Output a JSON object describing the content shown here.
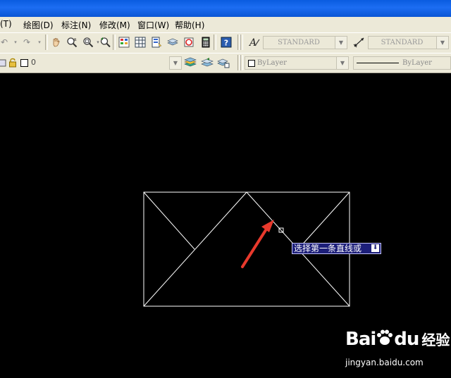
{
  "menubar": {
    "items": [
      {
        "label": "(T)"
      },
      {
        "label": "绘图(D)"
      },
      {
        "label": "标注(N)"
      },
      {
        "label": "修改(M)"
      },
      {
        "label": "窗口(W)"
      },
      {
        "label": "帮助(H)"
      }
    ]
  },
  "toolbar": {
    "text_style": "STANDARD",
    "dim_style": "STANDARD",
    "layer_value": "0",
    "color_value": "ByLayer",
    "linetype_value": "ByLayer"
  },
  "command_tooltip": {
    "text": "选择第一条直线或"
  },
  "watermark": {
    "brand": "Bai",
    "brand_suffix": "du",
    "product": "经验",
    "url": "jingyan.baidu.com"
  },
  "colors": {
    "titlebar": "#0a5ce0",
    "toolbar_bg": "#ece9d8",
    "canvas_bg": "#000000",
    "annotation_arrow": "#e8392c",
    "tooltip_bg": "#1d1f7a"
  }
}
